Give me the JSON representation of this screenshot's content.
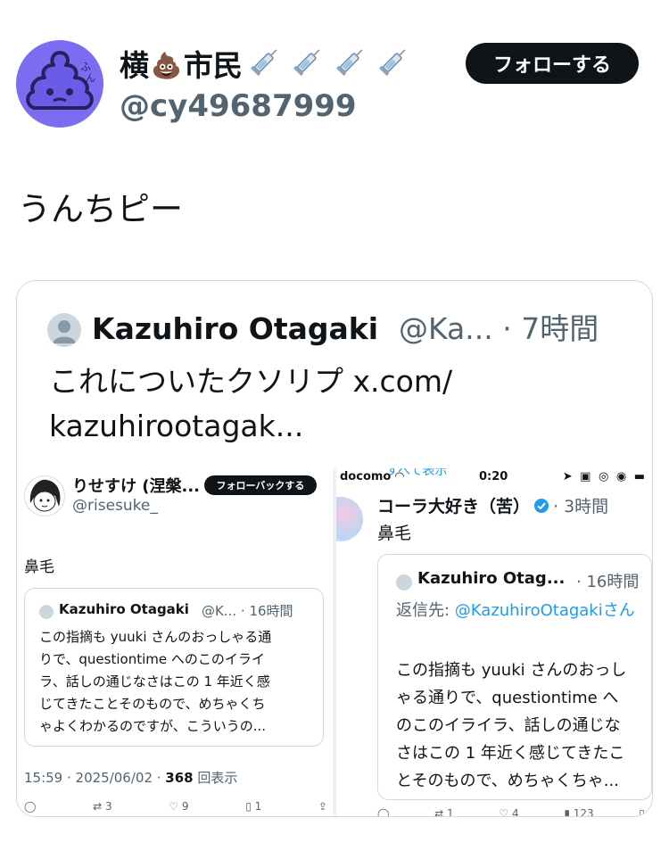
{
  "author": {
    "display_name_part1": "横",
    "display_name_emoji": "💩",
    "display_name_part2": "市民",
    "syringe_icon_count": 4,
    "handle": "@cy49687999"
  },
  "follow_button_label": "フォローする",
  "tweet_text": "うんちピー",
  "quote": {
    "name": "Kazuhiro Otagaki",
    "meta": "@Ka... · 7時間",
    "body_lines": [
      "これについたクソリプ x.com/",
      "kazuhirootagak..."
    ]
  },
  "left_screenshot": {
    "name": "りせすけ (涅槃...",
    "handle": "@risesuke_",
    "follow_label": "フォローバックする",
    "text": "鼻毛",
    "quoted": {
      "name": "Kazuhiro Otagaki",
      "meta": "@K... · 16時間",
      "body_lines": [
        "この指摘も yuuki さんのおっしゃる通",
        "りで、questiontime へのこのイライ",
        "ラ、話しの通じなさはこの 1 年近く感",
        "じてきたことそのもので、めちゃくち",
        "ゃよくわかるのですが、こういうの..."
      ]
    },
    "timestamp": "15:59 · 2025/06/02 · ",
    "views_count": "368",
    "views_label": " 回表示",
    "reply_icon": "comment-icon",
    "retweets": "3",
    "likes": "9",
    "bookmarks": "1"
  },
  "right_screenshot": {
    "carrier": "docomo",
    "time": "0:20",
    "hidden_text": "すべて表示",
    "name": "コーラ大好き（苦）",
    "meta": "· 3時間",
    "text": "鼻毛",
    "quoted": {
      "name": "Kazuhiro Otag...",
      "meta": "· 16時間",
      "reply_prefix": "返信先: ",
      "reply_mention": "@KazuhiroOtagakiさん",
      "body_lines": [
        "この指摘も yuuki さんのおっし",
        "ゃる通りで、questiontime へ",
        "のこのイライラ、話しの通じな",
        "さはこの 1 年近く感じてきたこ",
        "とそのもので、めちゃくちゃ..."
      ]
    },
    "retweets": "1",
    "likes": "4",
    "views": "123"
  },
  "colors": {
    "text": "#0f1419",
    "secondary": "#536471",
    "accent": "#1d9bf0",
    "avatar_bg": "#7b6cf2",
    "border": "#cfd9de"
  }
}
